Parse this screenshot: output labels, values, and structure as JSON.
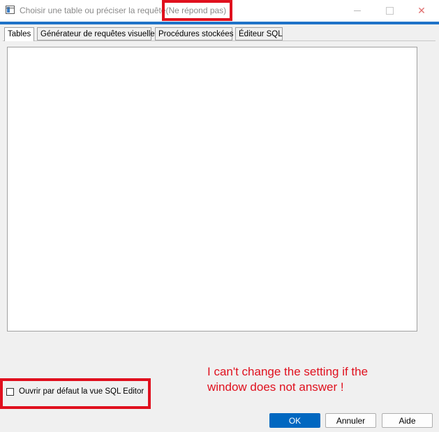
{
  "window": {
    "title": "Choisir une table ou préciser la requête",
    "status": "(Ne répond pas)",
    "controls": {
      "minimize_icon": "minimize-icon",
      "maximize_icon": "maximize-icon",
      "close_glyph": "✕"
    }
  },
  "tabs": [
    {
      "label": "Tables",
      "selected": true
    },
    {
      "label": "Générateur de requêtes visuelles",
      "selected": false
    },
    {
      "label": "Procédures stockées",
      "selected": false
    },
    {
      "label": "Éditeur SQL",
      "selected": false
    }
  ],
  "tables_list": {
    "items": []
  },
  "options": {
    "default_sql_editor_label": "Ouvrir par défaut la vue SQL Editor",
    "default_sql_editor_checked": false
  },
  "buttons": {
    "ok": "OK",
    "cancel": "Annuler",
    "help": "Aide"
  },
  "annotation": {
    "note": "I can't change the setting if the\nwindow does not answer !",
    "color": "#e0101e"
  },
  "colors": {
    "accent": "#1f73c8",
    "ok_button": "#0067c0"
  }
}
